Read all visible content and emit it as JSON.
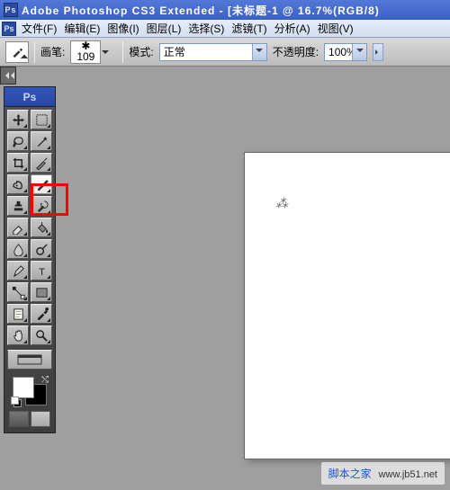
{
  "title": "Adobe Photoshop CS3 Extended - [未标题-1 @ 16.7%(RGB/8)",
  "menu": [
    "文件(F)",
    "编辑(E)",
    "图像(I)",
    "图层(L)",
    "选择(S)",
    "滤镜(T)",
    "分析(A)",
    "视图(V)"
  ],
  "options": {
    "brush_label": "画笔:",
    "brush_size": "109",
    "mode_label": "模式:",
    "mode_value": "正常",
    "opacity_label": "不透明度:",
    "opacity_value": "100%"
  },
  "toolbox_header": "Ps",
  "tools": [
    {
      "name": "move-tool",
      "icon": "move"
    },
    {
      "name": "rectangular-marquee-tool",
      "icon": "marquee"
    },
    {
      "name": "lasso-tool",
      "icon": "lasso"
    },
    {
      "name": "magic-wand-tool",
      "icon": "wand"
    },
    {
      "name": "crop-tool",
      "icon": "crop"
    },
    {
      "name": "slice-tool",
      "icon": "slice"
    },
    {
      "name": "healing-brush-tool",
      "icon": "heal"
    },
    {
      "name": "brush-tool",
      "icon": "brush",
      "selected": true
    },
    {
      "name": "clone-stamp-tool",
      "icon": "stamp"
    },
    {
      "name": "history-brush-tool",
      "icon": "history"
    },
    {
      "name": "eraser-tool",
      "icon": "eraser"
    },
    {
      "name": "paint-bucket-tool",
      "icon": "bucket"
    },
    {
      "name": "blur-tool",
      "icon": "blur"
    },
    {
      "name": "dodge-tool",
      "icon": "dodge"
    },
    {
      "name": "pen-tool",
      "icon": "pen"
    },
    {
      "name": "type-tool",
      "icon": "type"
    },
    {
      "name": "path-selection-tool",
      "icon": "path"
    },
    {
      "name": "rectangle-tool",
      "icon": "rect"
    },
    {
      "name": "notes-tool",
      "icon": "notes"
    },
    {
      "name": "eyedropper-tool",
      "icon": "eyedrop"
    },
    {
      "name": "hand-tool",
      "icon": "hand"
    },
    {
      "name": "zoom-tool",
      "icon": "zoom"
    }
  ],
  "colors": {
    "fg": "#ffffff",
    "bg": "#000000"
  },
  "watermark": {
    "main": "脚本之家",
    "sub": "www.jb51.net"
  },
  "highlight": {
    "target": "brush-tool"
  }
}
